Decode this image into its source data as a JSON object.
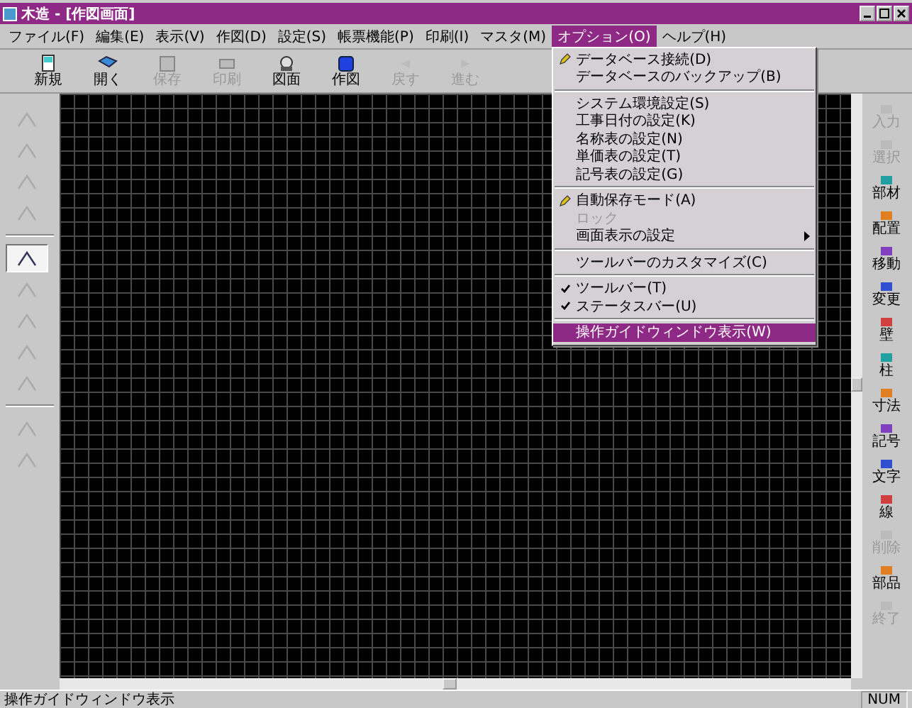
{
  "window": {
    "title": "木造 - [作図画面]"
  },
  "menu_bar": [
    {
      "label": "ファイル(F)",
      "selected": false
    },
    {
      "label": "編集(E)",
      "selected": false
    },
    {
      "label": "表示(V)",
      "selected": false
    },
    {
      "label": "作図(D)",
      "selected": false
    },
    {
      "label": "設定(S)",
      "selected": false
    },
    {
      "label": "帳票機能(P)",
      "selected": false
    },
    {
      "label": "印刷(I)",
      "selected": false
    },
    {
      "label": "マスタ(M)",
      "selected": false
    },
    {
      "label": "オプション(O)",
      "selected": true
    },
    {
      "label": "ヘルプ(H)",
      "selected": false
    }
  ],
  "dropdown": [
    {
      "kind": "item",
      "label": "データベース接続(D)",
      "icon": true,
      "checked": false,
      "disabled": false,
      "selected": false,
      "submenu": false
    },
    {
      "kind": "item",
      "label": "データベースのバックアップ(B)",
      "icon": false,
      "checked": false,
      "disabled": false,
      "selected": false,
      "submenu": false
    },
    {
      "kind": "separator"
    },
    {
      "kind": "item",
      "label": "システム環境設定(S)",
      "icon": false,
      "checked": false,
      "disabled": false,
      "selected": false,
      "submenu": false
    },
    {
      "kind": "item",
      "label": "工事日付の設定(K)",
      "icon": false,
      "checked": false,
      "disabled": false,
      "selected": false,
      "submenu": false
    },
    {
      "kind": "item",
      "label": "名称表の設定(N)",
      "icon": false,
      "checked": false,
      "disabled": false,
      "selected": false,
      "submenu": false
    },
    {
      "kind": "item",
      "label": "単価表の設定(T)",
      "icon": false,
      "checked": false,
      "disabled": false,
      "selected": false,
      "submenu": false
    },
    {
      "kind": "item",
      "label": "記号表の設定(G)",
      "icon": false,
      "checked": false,
      "disabled": false,
      "selected": false,
      "submenu": false
    },
    {
      "kind": "separator"
    },
    {
      "kind": "item",
      "label": "自動保存モード(A)",
      "icon": true,
      "checked": false,
      "disabled": false,
      "selected": false,
      "submenu": false
    },
    {
      "kind": "item",
      "label": "ロック",
      "icon": false,
      "checked": false,
      "disabled": true,
      "selected": false,
      "submenu": false
    },
    {
      "kind": "item",
      "label": "画面表示の設定",
      "icon": false,
      "checked": false,
      "disabled": false,
      "selected": false,
      "submenu": true
    },
    {
      "kind": "separator"
    },
    {
      "kind": "item",
      "label": "ツールバーのカスタマイズ(C)",
      "icon": false,
      "checked": false,
      "disabled": false,
      "selected": false,
      "submenu": false
    },
    {
      "kind": "separator"
    },
    {
      "kind": "item",
      "label": "ツールバー(T)",
      "icon": false,
      "checked": true,
      "disabled": false,
      "selected": false,
      "submenu": false
    },
    {
      "kind": "item",
      "label": "ステータスバー(U)",
      "icon": false,
      "checked": true,
      "disabled": false,
      "selected": false,
      "submenu": false
    },
    {
      "kind": "separator"
    },
    {
      "kind": "item",
      "label": "操作ガイドウィンドウ表示(W)",
      "icon": false,
      "checked": false,
      "disabled": false,
      "selected": true,
      "submenu": false
    }
  ],
  "toolbar": [
    {
      "label": "新規",
      "disabled": false
    },
    {
      "label": "開く",
      "disabled": false
    },
    {
      "label": "保存",
      "disabled": true
    },
    {
      "label": "印刷",
      "disabled": true
    },
    {
      "label": "図面",
      "disabled": false
    },
    {
      "label": "作図",
      "disabled": false
    },
    {
      "label": "戻す",
      "disabled": true
    },
    {
      "label": "進む",
      "disabled": true
    }
  ],
  "left_toolbar": [
    {
      "selected": false,
      "disabled": true
    },
    {
      "selected": false,
      "disabled": true
    },
    {
      "selected": false,
      "disabled": true
    },
    {
      "selected": false,
      "disabled": true
    },
    {
      "selected": true,
      "disabled": false
    },
    {
      "selected": false,
      "disabled": true
    },
    {
      "selected": false,
      "disabled": true
    },
    {
      "selected": false,
      "disabled": true
    },
    {
      "selected": false,
      "disabled": true
    },
    {
      "selected": false,
      "disabled": true
    },
    {
      "selected": false,
      "disabled": true
    }
  ],
  "right_toolbar": [
    {
      "label": "入力",
      "disabled": true
    },
    {
      "label": "選択",
      "disabled": true
    },
    {
      "label": "部材",
      "disabled": false
    },
    {
      "label": "配置",
      "disabled": false
    },
    {
      "label": "移動",
      "disabled": false
    },
    {
      "label": "変更",
      "disabled": false
    },
    {
      "label": "壁",
      "disabled": false
    },
    {
      "label": "柱",
      "disabled": false
    },
    {
      "label": "寸法",
      "disabled": false
    },
    {
      "label": "記号",
      "disabled": false
    },
    {
      "label": "文字",
      "disabled": false
    },
    {
      "label": "線",
      "disabled": false
    },
    {
      "label": "削除",
      "disabled": true
    },
    {
      "label": "部品",
      "disabled": false
    },
    {
      "label": "終了",
      "disabled": true
    }
  ],
  "status_bar": {
    "message": "操作ガイドウィンドウ表示",
    "indicator": "NUM"
  }
}
